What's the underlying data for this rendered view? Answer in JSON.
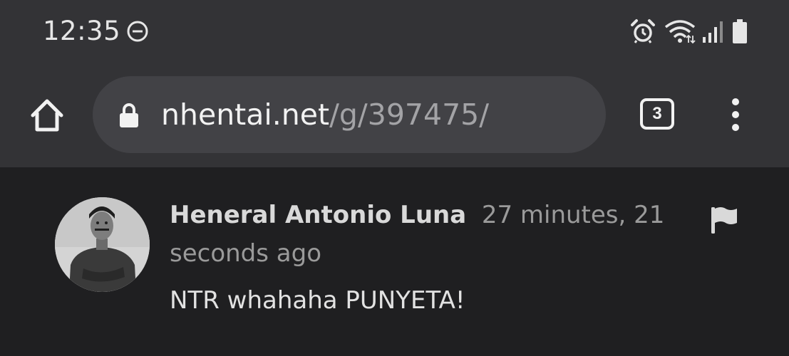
{
  "status_bar": {
    "time": "12:35",
    "icons": [
      "do-not-disturb-icon",
      "alarm-icon",
      "wifi-icon",
      "signal-icon",
      "battery-icon"
    ]
  },
  "toolbar": {
    "url_domain": "nhentai.net",
    "url_path": "/g/397475/",
    "tab_count": "3",
    "icons": [
      "home-icon",
      "lock-icon",
      "tab-switcher-icon",
      "more-options-icon"
    ]
  },
  "comment": {
    "author": "Heneral Antonio Luna",
    "timestamp": "27 minutes, 21 seconds ago",
    "body": "NTR whahaha PUNYETA!",
    "icons": [
      "avatar",
      "flag-icon"
    ]
  },
  "colors": {
    "chrome_bar": "#333336",
    "omnibox": "#424246",
    "page_background": "#1f1f21",
    "text_primary": "#e2e2e2",
    "text_secondary": "#9a9a9a"
  }
}
